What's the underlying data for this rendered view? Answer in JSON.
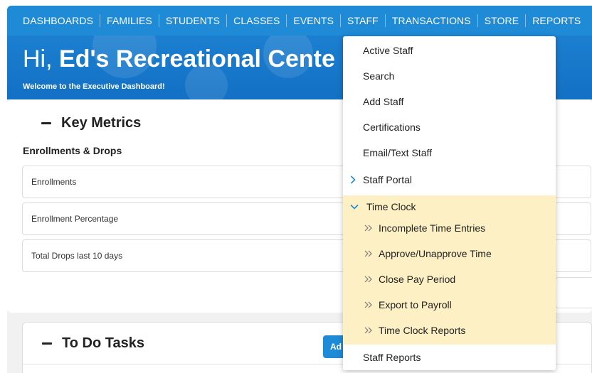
{
  "nav": {
    "items": [
      "DASHBOARDS",
      "FAMILIES",
      "STUDENTS",
      "CLASSES",
      "EVENTS",
      "STAFF",
      "TRANSACTIONS",
      "STORE",
      "REPORTS"
    ]
  },
  "hero": {
    "greeting": "Hi,",
    "org_name": "Ed's Recreational Cente",
    "subtitle": "Welcome to the Executive Dashboard!"
  },
  "main": {
    "key_metrics_title": "Key Metrics",
    "enrollments_heading": "Enrollments & Drops",
    "metrics": [
      "Enrollments",
      "Enrollment Percentage",
      "Total Drops last 10 days"
    ],
    "todo_title": "To Do Tasks",
    "add_label": "Ad"
  },
  "staff_menu": {
    "items": [
      "Active Staff",
      "Search",
      "Add Staff",
      "Certifications",
      "Email/Text Staff",
      "Staff Portal"
    ],
    "time_clock": {
      "label": "Time Clock",
      "items": [
        "Incomplete Time Entries",
        "Approve/Unapprove Time",
        "Close Pay Period",
        "Export to Payroll",
        "Time Clock Reports"
      ]
    },
    "staff_reports": "Staff Reports"
  },
  "icons": {
    "submenu_collapsed": "chevron-right-icon",
    "submenu_expanded": "chevron-down-icon",
    "submenu_child": "double-chevron-right-icon"
  },
  "colors": {
    "brand_blue": "#1f8ad6",
    "highlight": "#fdf0c4"
  }
}
